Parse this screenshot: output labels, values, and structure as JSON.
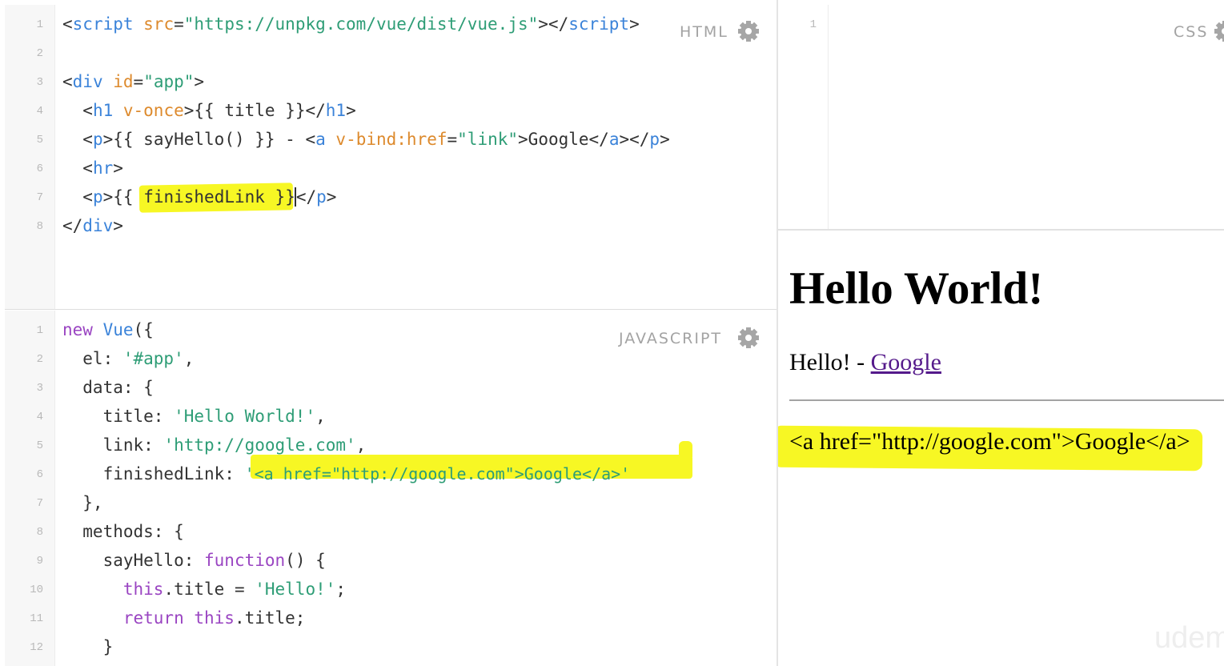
{
  "html_pane": {
    "label": "HTML",
    "line_numbers": [
      "1",
      "2",
      "3",
      "4",
      "5",
      "6",
      "7",
      "8"
    ],
    "lines": {
      "l1": {
        "lt": "<",
        "tag": "script",
        "attr": " src",
        "eq": "=",
        "val": "\"https://unpkg.com/vue/dist/vue.js\"",
        "gt": ">",
        "close_open": "</",
        "close_tag": "script",
        "close_gt": ">"
      },
      "l3": {
        "lt": "<",
        "tag": "div",
        "attr": " id",
        "eq": "=",
        "val": "\"app\"",
        "gt": ">"
      },
      "l4": {
        "lt": "  <",
        "tag": "h1",
        "attr": " v-once",
        "gt": ">",
        "text": "{{ title }}",
        "close_open": "</",
        "close_tag": "h1",
        "close_gt": ">"
      },
      "l5": {
        "lt": "  <",
        "tag": "p",
        "gt": ">",
        "text": "{{ sayHello() }} - ",
        "a_lt": "<",
        "a_tag": "a",
        "a_attr": " v-bind:href",
        "a_eq": "=",
        "a_val": "\"link\"",
        "a_gt": ">",
        "a_text": "Google",
        "a_close_open": "</",
        "a_close_tag": "a",
        "a_close_gt": "></",
        "p_close_tag": "p",
        "p_close_gt": ">"
      },
      "l6": {
        "lt": "  <",
        "tag": "hr",
        "gt": ">"
      },
      "l7": {
        "lt": "  <",
        "tag": "p",
        "gt": ">",
        "text_a": "{{ ",
        "text_b": "finishedLink",
        "text_c": " }}",
        "close_open": "</",
        "close_tag": "p",
        "close_gt": ">"
      },
      "l8": {
        "lt": "</",
        "tag": "div",
        "gt": ">"
      }
    }
  },
  "js_pane": {
    "label": "JAVASCRIPT",
    "line_numbers": [
      "1",
      "2",
      "3",
      "4",
      "5",
      "6",
      "7",
      "8",
      "9",
      "10",
      "11",
      "12"
    ],
    "lines": {
      "l1": {
        "kw": "new",
        "cls": " Vue",
        "rest": "({"
      },
      "l2": {
        "key": "  el: ",
        "val": "'#app'",
        "rest": ","
      },
      "l3": {
        "key": "  data: {"
      },
      "l4": {
        "key": "    title: ",
        "val": "'Hello World!'",
        "rest": ","
      },
      "l5": {
        "key": "    link: ",
        "val": "'http://google.com'",
        "rest": ","
      },
      "l6": {
        "key": "    finishedLink: ",
        "val": "'<a href=\"http://google.com\">Google</a>'"
      },
      "l7": {
        "key": "  },"
      },
      "l8": {
        "key": "  methods: {"
      },
      "l9": {
        "key": "    sayHello: ",
        "kw": "function",
        "rest": "() {"
      },
      "l10": {
        "kw": "      this",
        "rest": ".title = ",
        "val": "'Hello!'",
        "end": ";"
      },
      "l11": {
        "kw": "      return",
        "kw2": " this",
        "rest": ".title;"
      },
      "l12": {
        "key": "    }"
      }
    }
  },
  "css_pane": {
    "label": "CSS",
    "line_numbers": [
      "1"
    ]
  },
  "output": {
    "heading": "Hello World!",
    "para_prefix": "Hello! - ",
    "link_text": "Google",
    "raw_html": "<a href=\"http://google.com\">Google</a>"
  },
  "colors": {
    "tag": "#3b83d9",
    "attribute": "#dd8a2d",
    "string": "#2e9d76",
    "keyword": "#9a45c2",
    "highlight": "#f7f724",
    "link": "#551a8b"
  },
  "icons": [
    "gear-icon"
  ],
  "watermark": "udem"
}
